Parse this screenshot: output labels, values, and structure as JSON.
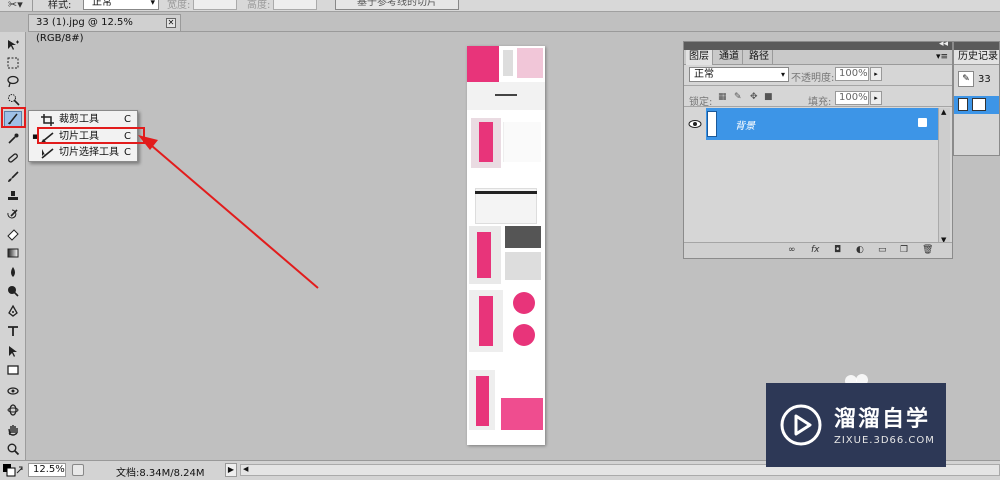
{
  "options_bar": {
    "style_label": "样式:",
    "style_value": "正常",
    "width_label": "宽度:",
    "height_label": "高度:",
    "guides_button": "基于参考线的切片"
  },
  "document_tab": {
    "title": "33 (1).jpg @ 12.5%(RGB/8#)",
    "close": "✕"
  },
  "toolbox": {
    "tools": [
      "move-icon",
      "marquee-icon",
      "lasso-icon",
      "quick-select-icon",
      "crop-icon",
      "eyedropper-icon",
      "healing-icon",
      "brush-icon",
      "stamp-icon",
      "history-brush-icon",
      "eraser-icon",
      "gradient-icon",
      "blur-icon",
      "dodge-icon",
      "pen-icon",
      "type-icon",
      "path-select-icon",
      "shape-icon",
      "3d-rotate-icon",
      "3d-orbit-icon",
      "hand-icon",
      "zoom-icon"
    ]
  },
  "flyout": {
    "items": [
      {
        "label": "裁剪工具",
        "key": "C",
        "selected": false
      },
      {
        "label": "切片工具",
        "key": "C",
        "selected": true
      },
      {
        "label": "切片选择工具",
        "key": "C",
        "selected": false
      }
    ]
  },
  "layers_panel": {
    "tabs": [
      "图层",
      "通道",
      "路径"
    ],
    "active_tab": "图层",
    "blend_mode": "正常",
    "opacity_label": "不透明度:",
    "opacity_value": "100%",
    "lock_label": "锁定:",
    "fill_label": "填充:",
    "fill_value": "100%",
    "layers": [
      {
        "name": "背景",
        "selected": true,
        "visible": true,
        "locked": true
      }
    ]
  },
  "history_panel": {
    "tab": "历史记录",
    "first_state": "33"
  },
  "status_bar": {
    "zoom": "12.5%",
    "doc_info": "文档:8.34M/8.24M"
  },
  "watermark": {
    "brand": "溜溜自学",
    "url": "ZIXUE.3D66.COM"
  },
  "colors": {
    "highlight": "#3d95e7",
    "annotation_red": "#e21c1c",
    "canvas_bg": "#c0c0c0",
    "panel_bg": "#d6d6d6",
    "accent_pink": "#e8347a"
  }
}
